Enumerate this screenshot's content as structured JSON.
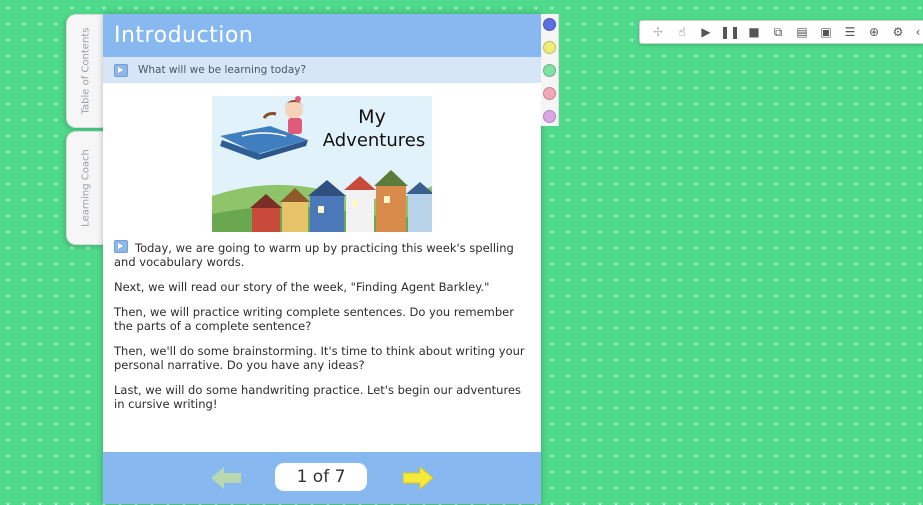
{
  "side_tabs": {
    "toc_label": "Table of Contents",
    "coach_label": "Learning Coach"
  },
  "panel": {
    "title": "Introduction",
    "subtitle": "What will we be learning today?",
    "illustration": {
      "title_line1": "My",
      "title_line2": "Adventures"
    },
    "paragraphs": [
      "Today, we are going to warm up by practicing this week's spelling and vocabulary words.",
      "Next, we will read our story of the week, \"Finding Agent Barkley.\"",
      "Then, we will practice writing complete sentences. Do you remember the parts of a complete sentence?",
      "Then, we'll do some brainstorming. It's time to think about writing your personal narrative. Do you have any ideas?",
      "Last, we will do some handwriting practice. Let's begin our adventures in cursive writing!"
    ],
    "footer": {
      "page_indicator": "1 of 7"
    }
  },
  "colors": {
    "accent": "#87b9f0",
    "background": "#4fd98a",
    "swatches": [
      "#5a6fe0",
      "#f0ec7a",
      "#7fe0a4",
      "#f2a9b6",
      "#d9a6e6"
    ]
  },
  "toolbar": {
    "icons": [
      "move-icon",
      "hand-pointer-icon",
      "play-icon",
      "pause-icon",
      "stop-icon",
      "copy-icon",
      "book-icon",
      "image-icon",
      "caption-icon",
      "zoom-icon",
      "gear-icon",
      "collapse-chevron-icon"
    ]
  }
}
